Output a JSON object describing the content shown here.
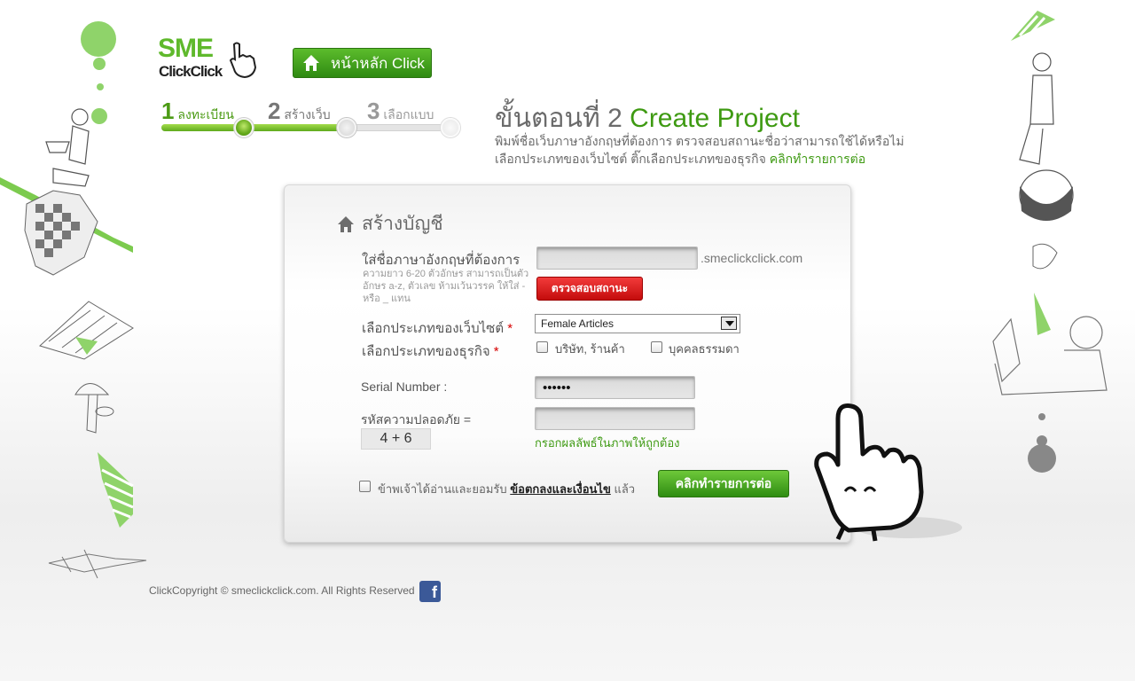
{
  "logo": {
    "line1": "SME",
    "line2": "ClickClick"
  },
  "nav": {
    "home_label": "หน้าหลัก Click"
  },
  "steps": [
    {
      "num": "1",
      "label": "ลงทะเบียน"
    },
    {
      "num": "2",
      "label": "สร้างเว็บ"
    },
    {
      "num": "3",
      "label": "เลือกแบบ"
    }
  ],
  "step_progress": 0.63,
  "header": {
    "title_th": "ขั้นตอนที่ 2 ",
    "title_en": "Create Project",
    "instruction_line1": "พิมพ์ชื่อเว็บภาษาอังกฤษที่ต้องการ  ตรวจสอบสถานะชื่อว่าสามารถใช้ได้หรือไม่",
    "instruction_line2": "เลือกประเภทของเว็บไซต์  ติ๊กเลือกประเภทของธุรกิจ ",
    "instruction_link": "คลิกทำรายการต่อ"
  },
  "form": {
    "title": "สร้างบัญชี",
    "site_name": {
      "label": "ใส่ชื่อภาษาอังกฤษที่ต้องการ",
      "value": "",
      "suffix": ".smeclickclick.com",
      "hint": "ความยาว 6-20 ตัวอักษร สามารถเป็นตัวอักษร a-z, ตัวเลข ห้ามเว้นวรรค ให้ใส่ - หรือ _ แทน",
      "check_button": "ตรวจสอบสถานะ"
    },
    "site_type": {
      "label": "เลือกประเภทของเว็บไซต์",
      "required_mark": "*",
      "selected": "Female Articles"
    },
    "business_type": {
      "label": "เลือกประเภทของธุรกิจ",
      "required_mark": "*",
      "options": [
        {
          "label": "บริษัท, ร้านค้า",
          "checked": false
        },
        {
          "label": "บุคคลธรรมดา",
          "checked": false
        }
      ]
    },
    "serial": {
      "label": "Serial Number  :",
      "value": "••••••"
    },
    "captcha": {
      "label": "รหัสความปลอดภัย  =",
      "question": "4 + 6",
      "value": "",
      "hint": "กรอกผลลัพธ์ในภาพให้ถูกต้อง"
    },
    "agree": {
      "prefix": "ข้าพเจ้าได้อ่านและยอมรับ ",
      "terms_link": "ข้อตกลงและเงื่อนไข",
      "suffix": " แล้ว",
      "checked": false
    },
    "submit_label": "คลิกทำรายการต่อ"
  },
  "footer": {
    "text": "ClickCopyright © smeclickclick.com. All Rights Reserved",
    "facebook_glyph": "f"
  },
  "colors": {
    "brand_green": "#3e9a12",
    "alert_red": "#d60000",
    "button_green": "#4aa81f"
  }
}
